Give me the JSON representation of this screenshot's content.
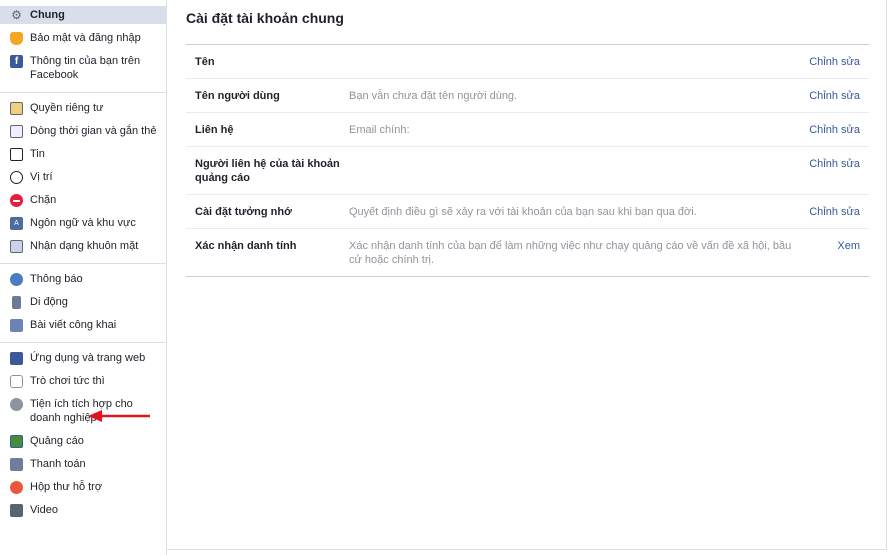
{
  "sidebar": {
    "groups": [
      {
        "items": [
          {
            "label": "Chung",
            "icon": "gear-icon",
            "active": true
          },
          {
            "label": "Bảo mật và đăng nhập",
            "icon": "security-shield-icon"
          },
          {
            "label": "Thông tin của bạn trên Facebook",
            "icon": "facebook-icon"
          }
        ]
      },
      {
        "items": [
          {
            "label": "Quyền riêng tư",
            "icon": "privacy-lock-icon"
          },
          {
            "label": "Dòng thời gian và gắn thẻ",
            "icon": "timeline-icon"
          },
          {
            "label": "Tin",
            "icon": "stories-book-icon"
          },
          {
            "label": "Vị trí",
            "icon": "location-icon"
          },
          {
            "label": "Chặn",
            "icon": "block-icon"
          },
          {
            "label": "Ngôn ngữ và khu vực",
            "icon": "language-icon"
          },
          {
            "label": "Nhận dạng khuôn mặt",
            "icon": "face-recognition-icon"
          }
        ]
      },
      {
        "items": [
          {
            "label": "Thông báo",
            "icon": "globe-icon"
          },
          {
            "label": "Di động",
            "icon": "mobile-icon"
          },
          {
            "label": "Bài viết công khai",
            "icon": "public-posts-icon"
          }
        ]
      },
      {
        "items": [
          {
            "label": "Ứng dụng và trang web",
            "icon": "apps-icon"
          },
          {
            "label": "Trò chơi tức thì",
            "icon": "gamepad-icon"
          },
          {
            "label": "Tiện ích tích hợp cho doanh nghiệp",
            "icon": "business-integration-icon"
          },
          {
            "label": "Quảng cáo",
            "icon": "ads-icon"
          },
          {
            "label": "Thanh toán",
            "icon": "payment-card-icon"
          },
          {
            "label": "Hộp thư hỗ trợ",
            "icon": "support-lifebuoy-icon"
          },
          {
            "label": "Video",
            "icon": "video-film-icon"
          }
        ]
      }
    ]
  },
  "main": {
    "title": "Cài đặt tài khoản chung",
    "rows": [
      {
        "label": "Tên",
        "value": "",
        "action": "Chỉnh sửa"
      },
      {
        "label": "Tên người dùng",
        "value": "Bạn vẫn chưa đặt tên người dùng.",
        "action": "Chỉnh sửa"
      },
      {
        "label": "Liên hệ",
        "value": "Email chính:",
        "action": "Chỉnh sửa"
      },
      {
        "label": "Người liên hệ của tài khoản quảng cáo",
        "value": "",
        "action": "Chỉnh sửa"
      },
      {
        "label": "Cài đặt tưởng nhớ",
        "value": "Quyết định điều gì sẽ xảy ra với tài khoản của bạn sau khi bạn qua đời.",
        "action": "Chỉnh sửa"
      },
      {
        "label": "Xác nhận danh tính",
        "value": "Xác nhận danh tính của bạn để làm những việc như chạy quảng cáo về vấn đề xã hội, bầu cử hoặc chính trị.",
        "action": "Xem"
      }
    ]
  },
  "annotation": {
    "arrow_color": "#e0141e",
    "points_to": "Quảng cáo"
  }
}
